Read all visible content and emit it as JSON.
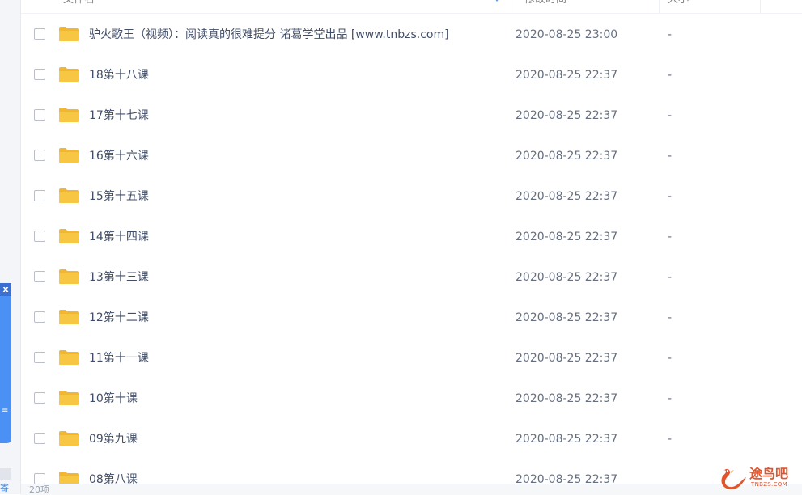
{
  "header": {
    "col_name": "文件名",
    "col_time": "修改时间",
    "col_size": "大小"
  },
  "side": {
    "close_label": "x",
    "mark": "≡",
    "bottom_text": "寄"
  },
  "files": [
    {
      "name": "驴火歌王（视频）：阅读真的很难提分 诸葛学堂出品 [www.tnbzs.com]",
      "time": "2020-08-25 23:00",
      "size": "-"
    },
    {
      "name": "18第十八课",
      "time": "2020-08-25 22:37",
      "size": "-"
    },
    {
      "name": "17第十七课",
      "time": "2020-08-25 22:37",
      "size": "-"
    },
    {
      "name": "16第十六课",
      "time": "2020-08-25 22:37",
      "size": "-"
    },
    {
      "name": "15第十五课",
      "time": "2020-08-25 22:37",
      "size": "-"
    },
    {
      "name": "14第十四课",
      "time": "2020-08-25 22:37",
      "size": "-"
    },
    {
      "name": "13第十三课",
      "time": "2020-08-25 22:37",
      "size": "-"
    },
    {
      "name": "12第十二课",
      "time": "2020-08-25 22:37",
      "size": "-"
    },
    {
      "name": "11第十一课",
      "time": "2020-08-25 22:37",
      "size": "-"
    },
    {
      "name": "10第十课",
      "time": "2020-08-25 22:37",
      "size": "-"
    },
    {
      "name": "09第九课",
      "time": "2020-08-25 22:37",
      "size": "-"
    },
    {
      "name": "08第八课",
      "time": "2020-08-25 22:37",
      "size": ""
    }
  ],
  "footer": {
    "status": "20项"
  },
  "watermark": {
    "name": "途鸟吧",
    "url": "TNBZS.COM"
  },
  "colors": {
    "folder": "#f7c744",
    "accent": "#4a90f5",
    "watermark": "#e2542a"
  },
  "icons": {
    "folder": "folder-icon",
    "checkbox": "checkbox-icon",
    "sort": "sort-down-icon",
    "close": "close-icon"
  }
}
